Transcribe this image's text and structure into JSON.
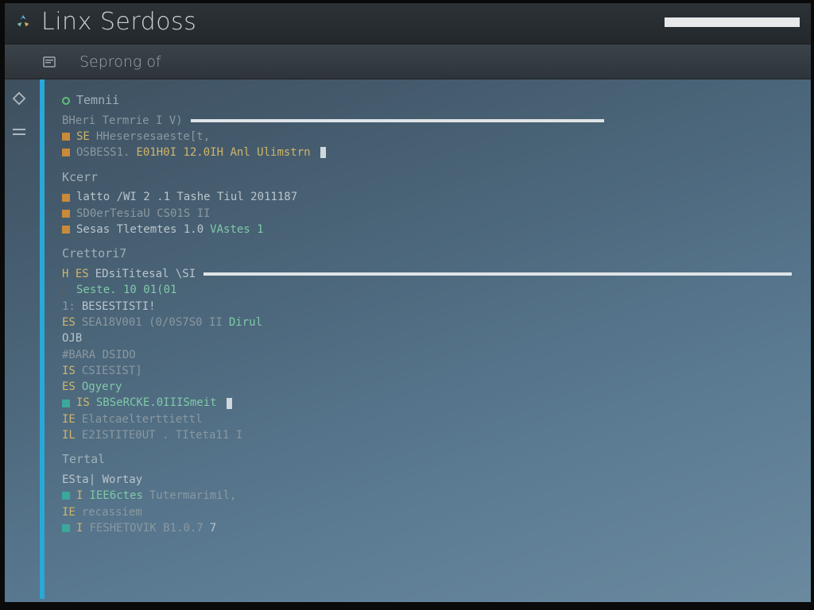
{
  "titlebar": {
    "title": "Linx Serdoss"
  },
  "subheader": {
    "breadcrumb": "Seprong of"
  },
  "sections": {
    "s0": {
      "head": "Temnii",
      "l0_a": "BHeri Termrie I V)",
      "l1_a": "SE",
      "l1_b": "HHesersesaeste[t,",
      "l2_a": "OSBESS1.",
      "l2_b": "E01H0I 12.0IH Anl Ulimstrn"
    },
    "s1": {
      "head": "Kcerr",
      "l0_a": "latto /WI 2 .1 Tashe Tiul 2011187",
      "l1_a": "SD0erTesiaU CS01S II",
      "l2_a": "Sesas Tletemtes 1.0",
      "l2_b": "VAstes 1"
    },
    "s2": {
      "head": "Crettori7",
      "l0_a": "H ES",
      "l0_b": "EDsiTitesal \\SI",
      "l1_a": "Seste. 10 01(01",
      "l2_a": "1:",
      "l2_b": "BESESTISTI!",
      "l3_a": "ES",
      "l3_b": "SEA18V001 (0/0S7S0 II",
      "l3_c": "Dirul",
      "l4_a": "OJB",
      "l5_a": "#BARA DSIDO",
      "l6_a": "IS",
      "l6_b": "CSIESIST]",
      "l7_a": "ES",
      "l7_b": "Ogyery",
      "l8_a": "IS",
      "l8_b": "SBSeRCKE.0IIISmeit",
      "l9_a": "IE",
      "l9_b": "Elatcaelterttiettl",
      "l10_a": "IL",
      "l10_b": "E2ISTITE0UT . TIteta11 I"
    },
    "s3": {
      "head": "Tertal",
      "l0_a": "ESta| Wortay",
      "l1_a": "I",
      "l1_b": "IEE6ctes",
      "l1_c": "Tutermarimil,",
      "l2_a": "IE",
      "l2_b": "recassiem",
      "l3_a": "I",
      "l3_b": "FESHETOVIK B1.0.7",
      "l3_c": "7"
    }
  }
}
